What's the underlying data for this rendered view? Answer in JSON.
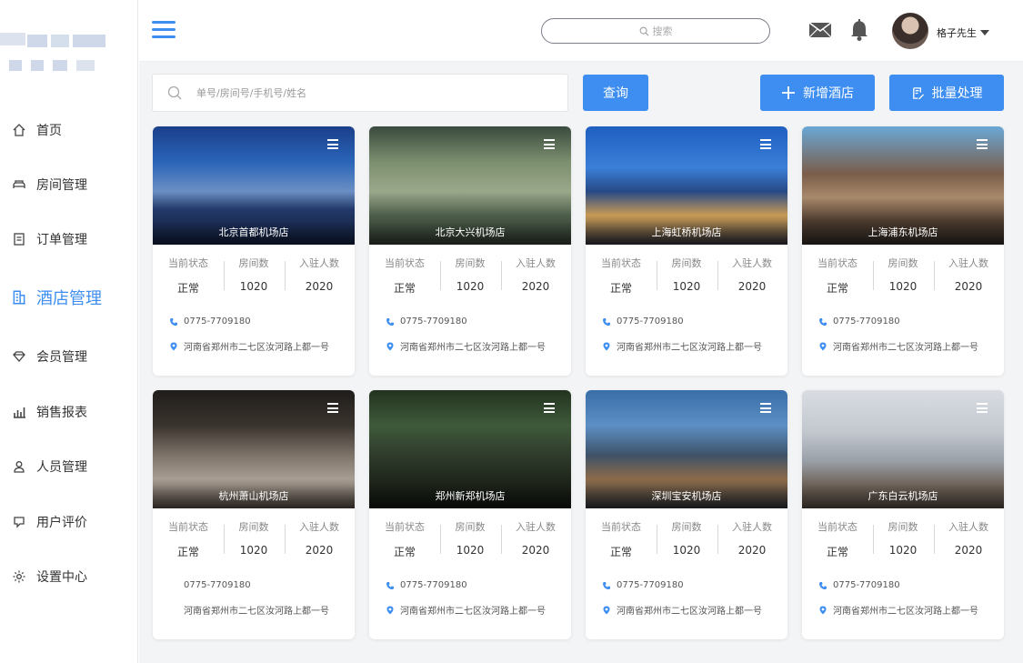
{
  "sidebar": {
    "items": [
      {
        "label": "首页",
        "icon": "home-icon"
      },
      {
        "label": "房间管理",
        "icon": "bed-icon"
      },
      {
        "label": "订单管理",
        "icon": "document-icon"
      },
      {
        "label": "酒店管理",
        "icon": "building-icon",
        "active": true
      },
      {
        "label": "会员管理",
        "icon": "diamond-icon"
      },
      {
        "label": "销售报表",
        "icon": "bar-chart-icon"
      },
      {
        "label": "人员管理",
        "icon": "person-icon"
      },
      {
        "label": "用户评价",
        "icon": "feedback-icon"
      },
      {
        "label": "设置中心",
        "icon": "gear-icon"
      }
    ]
  },
  "header": {
    "search_placeholder": "搜索",
    "user_name": "格子先生"
  },
  "toolbar": {
    "filter_placeholder": "单号/房间号/手机号/姓名",
    "query_label": "查询",
    "add_label": "新增酒店",
    "batch_label": "批量处理"
  },
  "stat_labels": {
    "status": "当前状态",
    "rooms": "房间数",
    "guests": "入驻人数"
  },
  "hotels": [
    {
      "name": "北京首都机场店",
      "status": "正常",
      "rooms": "1020",
      "guests": "2020",
      "phone": "0775-7709180",
      "address": "河南省郑州市二七区汝河路上都一号",
      "phone_icon": true
    },
    {
      "name": "北京大兴机场店",
      "status": "正常",
      "rooms": "1020",
      "guests": "2020",
      "phone": "0775-7709180",
      "address": "河南省郑州市二七区汝河路上都一号",
      "phone_icon": true
    },
    {
      "name": "上海虹桥机场店",
      "status": "正常",
      "rooms": "1020",
      "guests": "2020",
      "phone": "0775-7709180",
      "address": "河南省郑州市二七区汝河路上都一号",
      "phone_icon": true
    },
    {
      "name": "上海浦东机场店",
      "status": "正常",
      "rooms": "1020",
      "guests": "2020",
      "phone": "0775-7709180",
      "address": "河南省郑州市二七区汝河路上都一号",
      "phone_icon": true
    },
    {
      "name": "杭州萧山机场店",
      "status": "正常",
      "rooms": "1020",
      "guests": "2020",
      "phone": "0775-7709180",
      "address": "河南省郑州市二七区汝河路上都一号",
      "phone_icon": false
    },
    {
      "name": "郑州新郑机场店",
      "status": "正常",
      "rooms": "1020",
      "guests": "2020",
      "phone": "0775-7709180",
      "address": "河南省郑州市二七区汝河路上都一号",
      "phone_icon": true
    },
    {
      "name": "深圳宝安机场店",
      "status": "正常",
      "rooms": "1020",
      "guests": "2020",
      "phone": "0775-7709180",
      "address": "河南省郑州市二七区汝河路上都一号",
      "phone_icon": true
    },
    {
      "name": "广东白云机场店",
      "status": "正常",
      "rooms": "1020",
      "guests": "2020",
      "phone": "0775-7709180",
      "address": "河南省郑州市二七区汝河路上都一号",
      "phone_icon": true
    }
  ],
  "colors": {
    "accent": "#3d8ef0",
    "background": "#f3f4f6"
  }
}
